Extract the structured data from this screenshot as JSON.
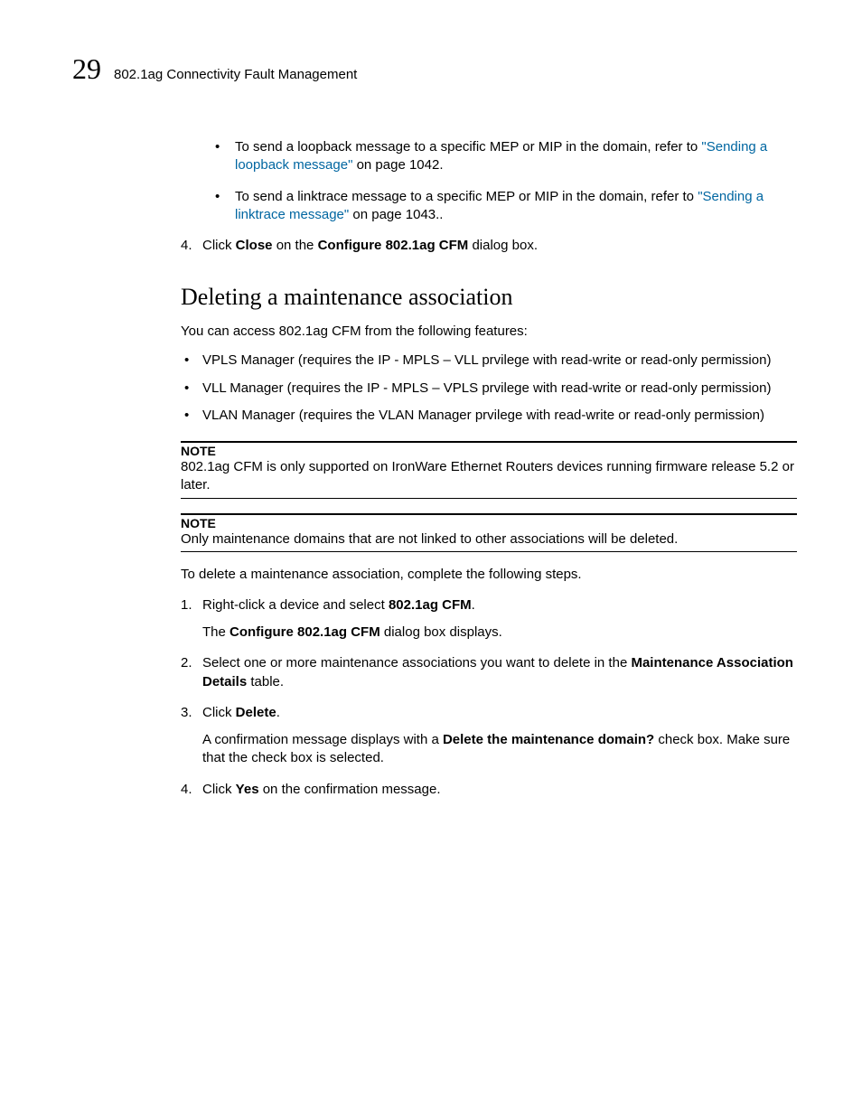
{
  "header": {
    "chapter_number": "29",
    "title": "802.1ag Connectivity Fault Management"
  },
  "top_bullets": [
    {
      "pre": "To send a loopback message to a specific MEP or MIP in the domain, refer to ",
      "link": "\"Sending a loopback message\"",
      "post": " on page 1042."
    },
    {
      "pre": "To send a linktrace message to a specific MEP or MIP in the domain, refer to ",
      "link": "\"Sending a linktrace message\"",
      "post": " on page 1043.."
    }
  ],
  "step4_prev": {
    "num": "4.",
    "pre": "Click ",
    "bold1": "Close",
    "mid": " on the ",
    "bold2": "Configure 802.1ag CFM",
    "post": " dialog box."
  },
  "section_heading": "Deleting a maintenance association",
  "intro": "You can access 802.1ag CFM from the following features:",
  "features": [
    "VPLS Manager (requires the IP - MPLS – VLL prvilege with read-write or read-only permission)",
    "VLL Manager (requires the IP - MPLS – VPLS prvilege with read-write or read-only permission)",
    "VLAN Manager (requires the VLAN Manager prvilege with read-write or read-only permission)"
  ],
  "note1": {
    "label": "NOTE",
    "text": "802.1ag CFM is only supported on IronWare Ethernet Routers devices running firmware release 5.2 or later."
  },
  "note2": {
    "label": "NOTE",
    "text": "Only maintenance domains that are not linked to other associations will be deleted."
  },
  "steps_intro": "To delete a maintenance association, complete the following steps.",
  "steps": {
    "s1": {
      "num": "1.",
      "pre": "Right-click a device and select ",
      "bold": "802.1ag CFM",
      "post": ".",
      "sub_pre": "The ",
      "sub_bold": "Configure 802.1ag CFM",
      "sub_post": " dialog box displays."
    },
    "s2": {
      "num": "2.",
      "pre": "Select one or more maintenance associations you want to delete in the ",
      "bold": "Maintenance Association Details",
      "post": " table."
    },
    "s3": {
      "num": "3.",
      "pre": "Click ",
      "bold": "Delete",
      "post": ".",
      "sub_pre": "A confirmation message displays with a ",
      "sub_bold": "Delete the maintenance domain?",
      "sub_post": " check box. Make sure that the check box is selected."
    },
    "s4": {
      "num": "4.",
      "pre": "Click ",
      "bold": "Yes",
      "post": " on the confirmation message."
    }
  }
}
